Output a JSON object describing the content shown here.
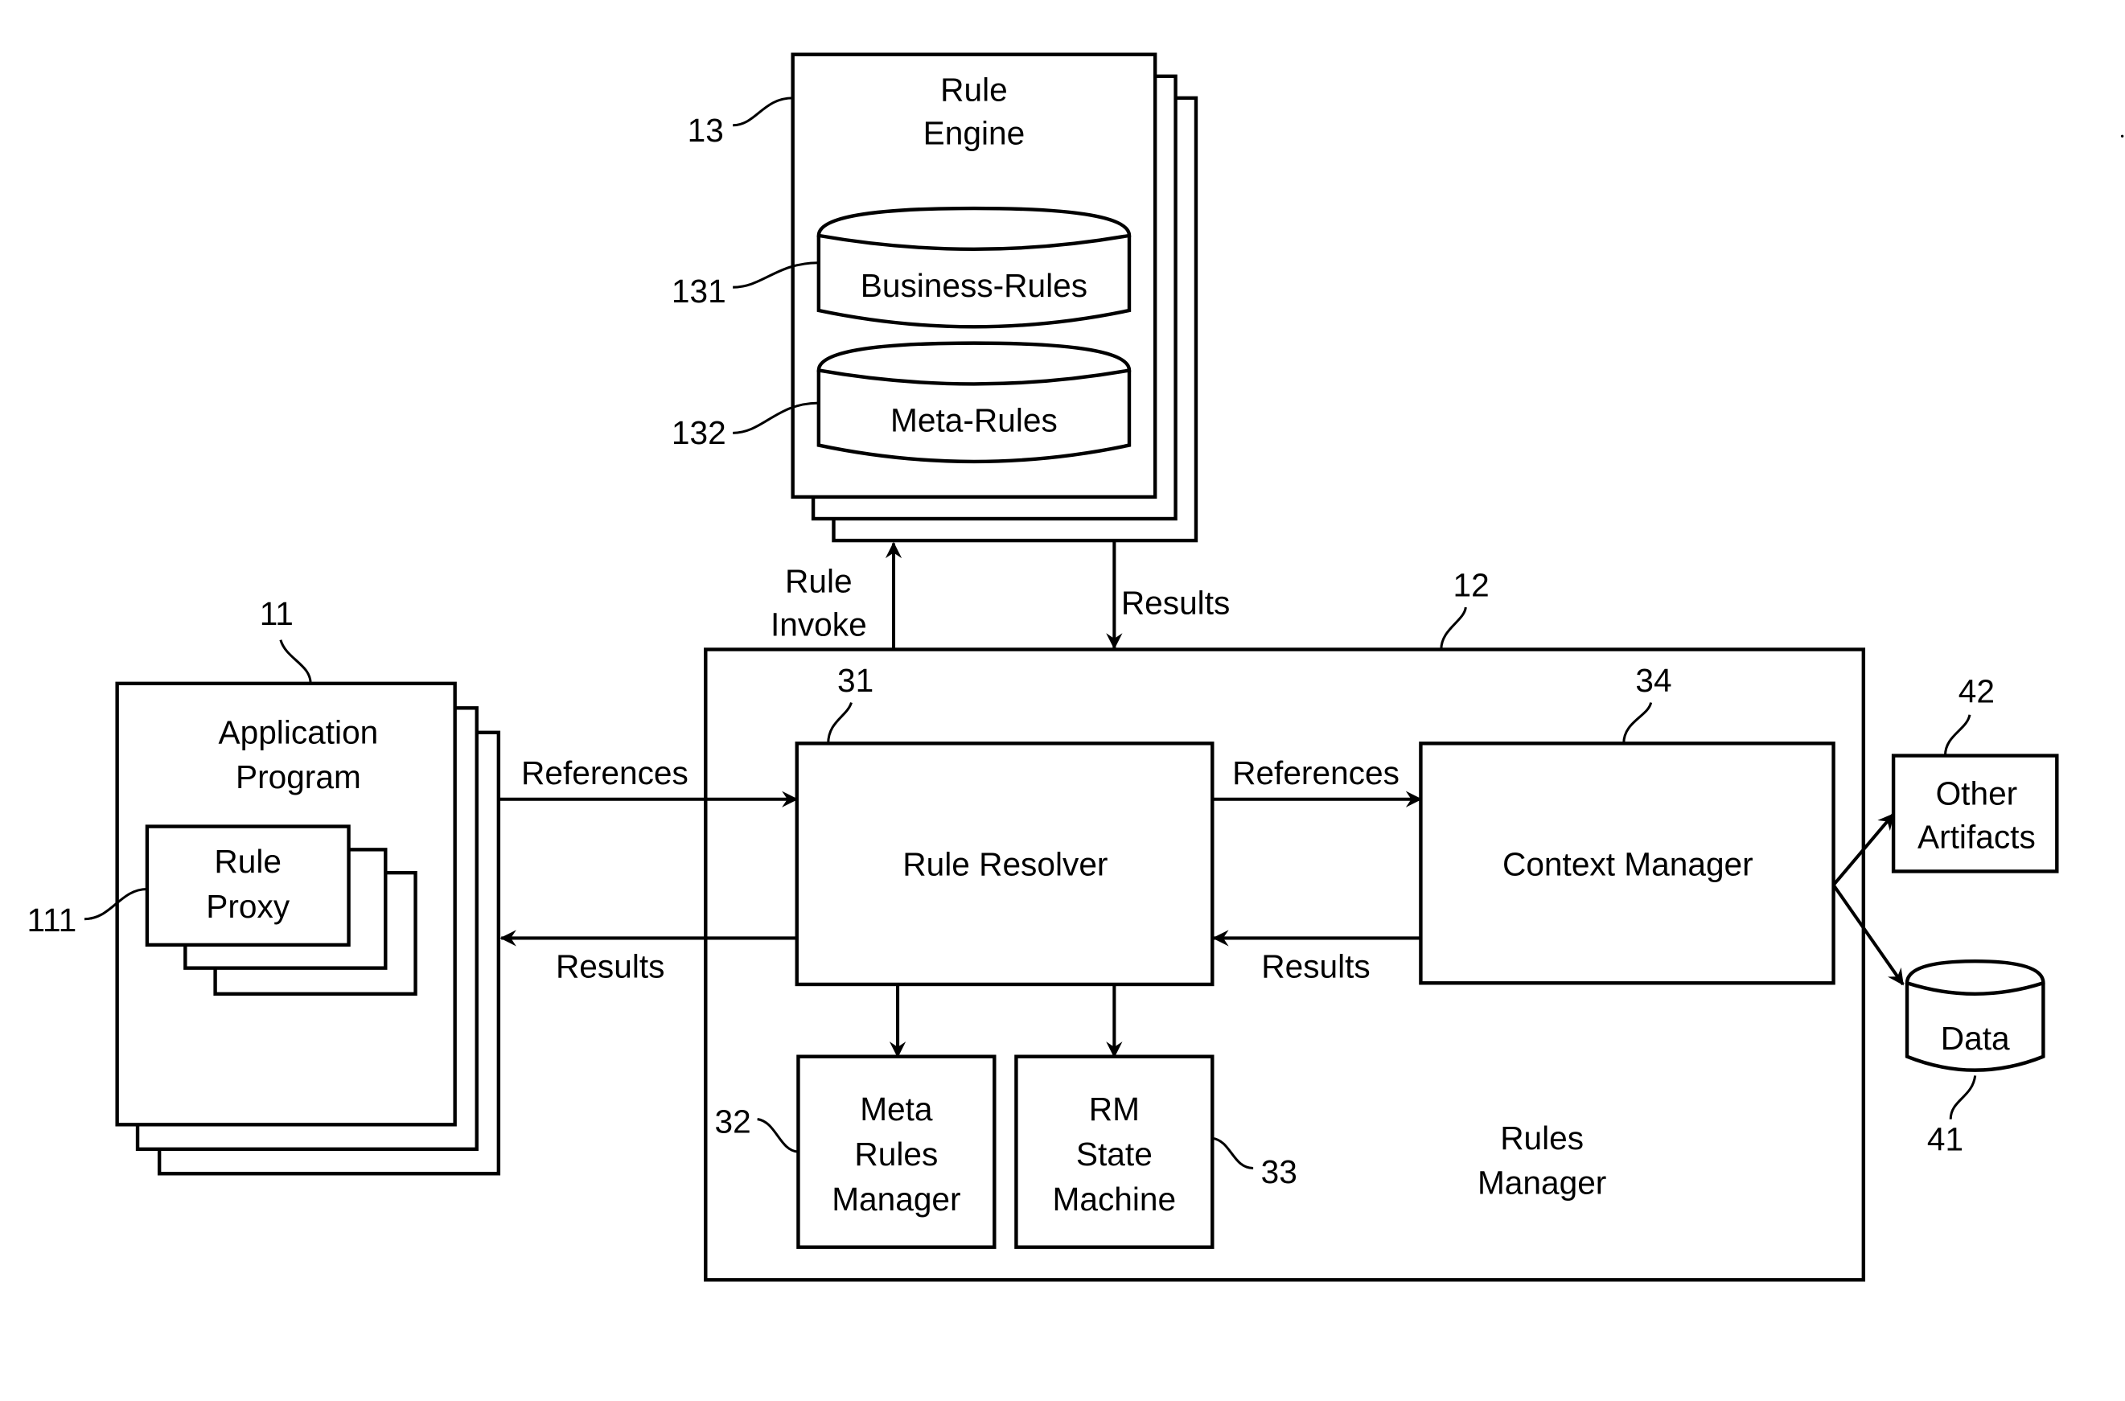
{
  "diagram": {
    "colors": {
      "stroke": "#000000",
      "background": "#ffffff"
    },
    "rule_engine": {
      "ref": "13",
      "title_lines": [
        "Rule",
        "Engine"
      ],
      "business_rules": {
        "ref": "131",
        "label": "Business-Rules"
      },
      "meta_rules": {
        "ref": "132",
        "label": "Meta-Rules"
      }
    },
    "application_program": {
      "ref": "11",
      "title_lines": [
        "Application",
        "Program"
      ],
      "rule_proxy": {
        "ref": "111",
        "title_lines": [
          "Rule",
          "Proxy"
        ]
      }
    },
    "rules_manager": {
      "ref": "12",
      "title_lines": [
        "Rules",
        "Manager"
      ],
      "rule_resolver": {
        "ref": "31",
        "label": "Rule Resolver"
      },
      "meta_rules_manager": {
        "ref": "32",
        "title_lines": [
          "Meta",
          "Rules",
          "Manager"
        ]
      },
      "rm_state_machine": {
        "ref": "33",
        "title_lines": [
          "RM",
          "State",
          "Machine"
        ]
      },
      "context_manager": {
        "ref": "34",
        "label": "Context Manager"
      }
    },
    "data_store": {
      "ref": "41",
      "label": "Data"
    },
    "other_artifacts": {
      "ref": "42",
      "title_lines": [
        "Other",
        "Artifacts"
      ]
    },
    "connections": {
      "rule_invoke": [
        "Rule",
        "Invoke"
      ],
      "engine_results": "Results",
      "app_references": "References",
      "app_results": "Results",
      "cm_references": "References",
      "cm_results": "Results"
    }
  }
}
